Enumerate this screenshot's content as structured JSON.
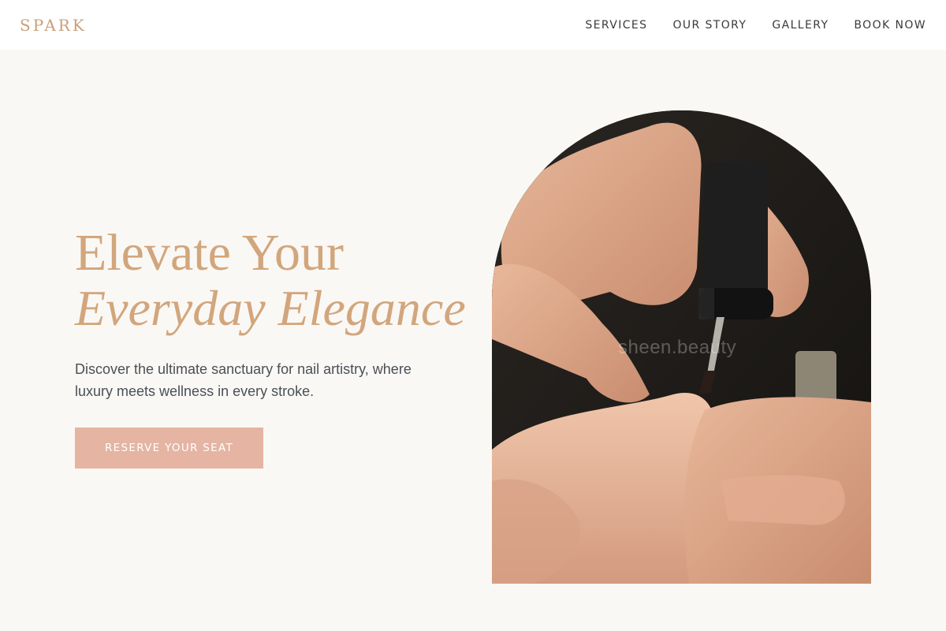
{
  "header": {
    "logo": "SPARK",
    "nav": [
      {
        "label": "SERVICES"
      },
      {
        "label": "OUR STORY"
      },
      {
        "label": "GALLERY"
      },
      {
        "label": "BOOK NOW"
      }
    ]
  },
  "hero": {
    "title_line1": "Elevate Your",
    "title_line2": "Everyday Elegance",
    "subtitle": "Discover the ultimate sanctuary for nail artistry, where luxury meets wellness in every stroke.",
    "cta_label": "RESERVE YOUR SEAT",
    "image_watermark": "sheen.beauty"
  },
  "colors": {
    "background": "#faf8f5",
    "accent_gold": "#d2a67c",
    "cta_bg": "#e5b4a3",
    "text": "#4a4f57"
  }
}
